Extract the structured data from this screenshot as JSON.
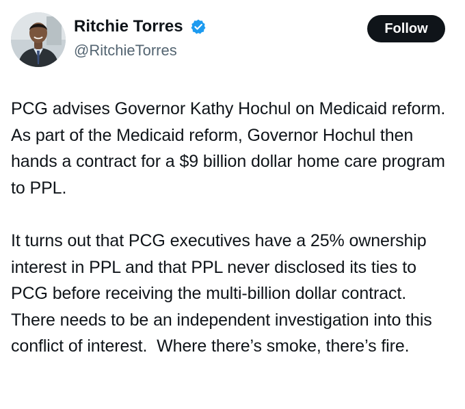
{
  "author": {
    "name": "Ritchie Torres",
    "handle": "@RitchieTorres",
    "verified": true,
    "verified_icon": "verified-badge-icon",
    "verified_color": "#1d9bf0"
  },
  "follow_button": {
    "label": "Follow",
    "background": "#0f1419",
    "text_color": "#ffffff"
  },
  "tweet": {
    "paragraphs": [
      "PCG advises Governor Kathy Hochul on Medicaid reform. As part of the Medicaid reform, Governor Hochul then hands a contract for a $9 billion dollar home care program to PPL.",
      "It turns out that PCG executives have a 25% ownership interest in PPL and that PPL never disclosed its ties to PCG before receiving the multi-billion dollar contract.  There needs to be an independent investigation into this conflict of interest.  Where there’s smoke, there’s fire."
    ]
  },
  "colors": {
    "text_primary": "#0f1419",
    "text_secondary": "#536471",
    "background": "#ffffff"
  }
}
